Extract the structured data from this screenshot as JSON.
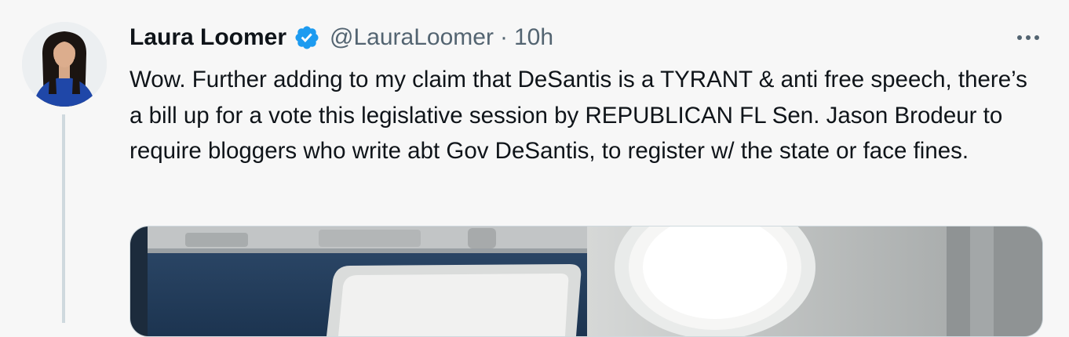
{
  "tweet": {
    "author": {
      "display_name": "Laura Loomer",
      "handle": "@LauraLoomer",
      "verified": true,
      "verified_icon": "verified-badge-icon",
      "avatar": "profile-photo"
    },
    "separator": "·",
    "timestamp": "10h",
    "more_icon": "more-options-icon",
    "text": "Wow. Further adding to my claim that DeSantis is a TYRANT & anti free speech, there’s a bill up for a vote this legislative session by REPUBLICAN FL Sen. Jason Brodeur to require bloggers who write abt Gov DeSantis, to register w/ the state or face fines.",
    "media": {
      "type": "photo",
      "subject": "airplane seat and window"
    }
  },
  "colors": {
    "background": "#f7f7f7",
    "text_primary": "#0f1419",
    "text_secondary": "#536471",
    "verified_blue": "#1d9bf0",
    "thread_line": "#cfd9de"
  }
}
